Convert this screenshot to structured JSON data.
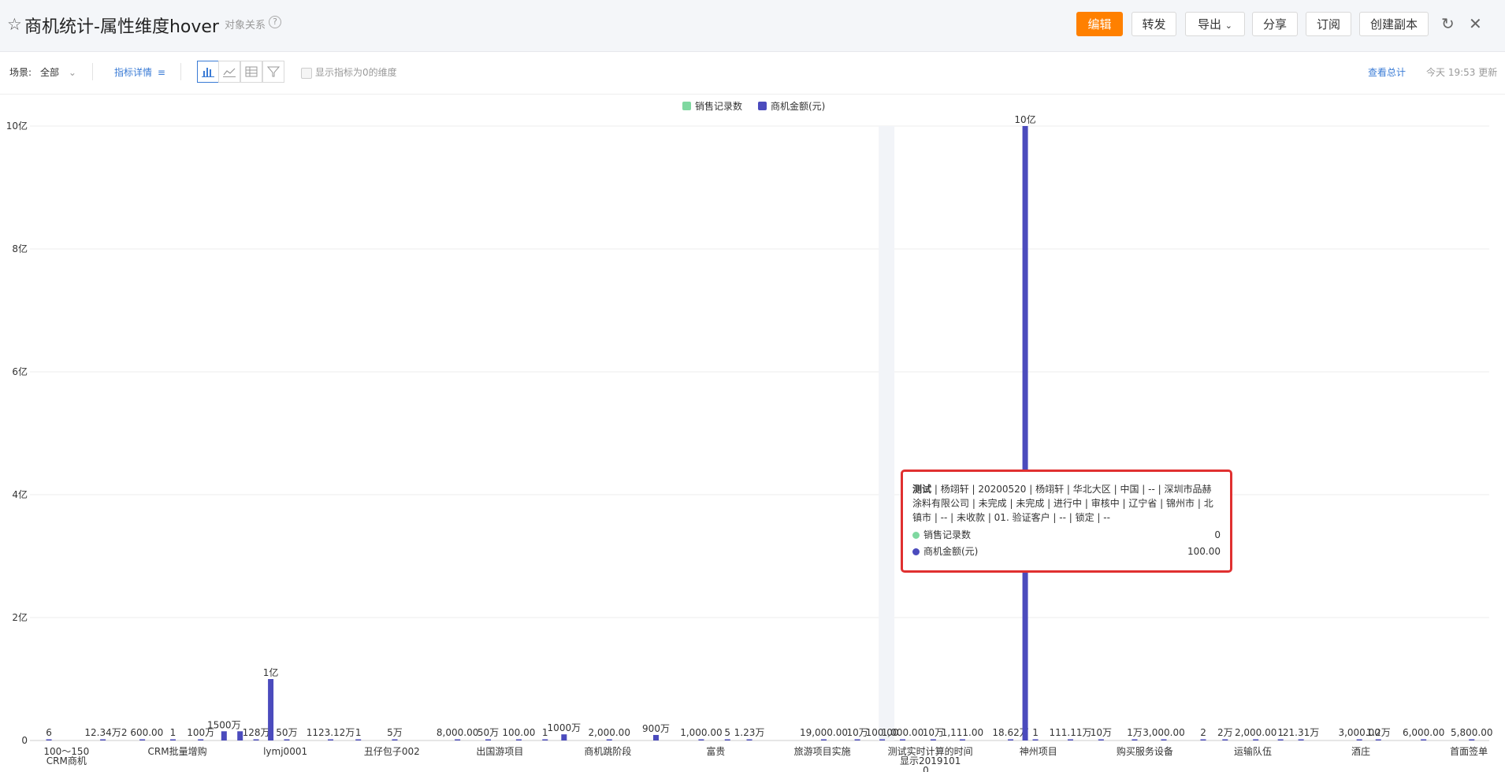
{
  "header": {
    "title": "商机统计-属性维度hover",
    "object_relation": "对象关系",
    "buttons": {
      "edit": "编辑",
      "forward": "转发",
      "export": "导出",
      "share": "分享",
      "subscribe": "订阅",
      "copy": "创建副本"
    }
  },
  "toolbar": {
    "scene_label": "场景:",
    "scene_value": "全部",
    "metric_details": "指标详情",
    "show_zero": "显示指标为0的维度",
    "view_total": "查看总计",
    "updated": "今天 19:53 更新"
  },
  "tooltip": {
    "title_bold": "测试",
    "title_rest": " | 杨翊轩 | 20200520 | 杨翊轩 | 华北大区 | 中国 | -- | 深圳市品赫涂料有限公司 | 未完成 | 未完成 | 进行中 | 审核中 | 辽宁省 | 锦州市 | 北镇市 | -- | 未收款 | 01. 验证客户 | -- | 锁定 | --",
    "rows": [
      {
        "label": "销售记录数",
        "value": "0",
        "color": "#7fd8a0"
      },
      {
        "label": "商机金额(元)",
        "value": "100.00",
        "color": "#4b4bbd"
      }
    ]
  },
  "chart_data": {
    "type": "bar",
    "legend": [
      {
        "name": "销售记录数",
        "color": "#7fd8a0"
      },
      {
        "name": "商机金额(元)",
        "color": "#4b4bbd"
      }
    ],
    "legend_position": "top-center",
    "grid": true,
    "y_ticks": [
      "0",
      "2亿",
      "4亿",
      "6亿",
      "8亿",
      "10亿"
    ],
    "ylim": [
      0,
      1000000000
    ],
    "x_tick_labels": [
      {
        "label": "100～150 CRM商机",
        "x": 0.025
      },
      {
        "label": "CRM批量增购",
        "x": 0.101
      },
      {
        "label": "lymj0001",
        "x": 0.175
      },
      {
        "label": "丑仔包子002",
        "x": 0.248
      },
      {
        "label": "出国游项目",
        "x": 0.322
      },
      {
        "label": "商机跳阶段",
        "x": 0.396
      },
      {
        "label": "富贵",
        "x": 0.47
      },
      {
        "label": "旅游项目实施",
        "x": 0.543
      },
      {
        "label": "测试实时计算的时间显示20191010...",
        "x": 0.617
      },
      {
        "label": "神州项目",
        "x": 0.691
      },
      {
        "label": "购买服务设备",
        "x": 0.764
      },
      {
        "label": "运输队伍",
        "x": 0.838
      },
      {
        "label": "酒庄",
        "x": 0.912
      },
      {
        "label": "首面签单",
        "x": 0.986
      }
    ],
    "bars": [
      {
        "x": 0.013,
        "value": 6,
        "label": "6"
      },
      {
        "x": 0.05,
        "value": 123400,
        "label": "12.34万"
      },
      {
        "x": 0.077,
        "value": 2600,
        "label": "2 600.00"
      },
      {
        "x": 0.098,
        "value": 1,
        "label": "1"
      },
      {
        "x": 0.117,
        "value": 1000000,
        "label": "100万"
      },
      {
        "x": 0.133,
        "value": 15000000,
        "label": "1500万"
      },
      {
        "x": 0.144,
        "value": 15000000,
        "label": ""
      },
      {
        "x": 0.155,
        "value": 1280000,
        "label": "128万"
      },
      {
        "x": 0.165,
        "value": 100000000,
        "label": "1亿"
      },
      {
        "x": 0.176,
        "value": 500000,
        "label": "50万"
      },
      {
        "x": 0.206,
        "value": 1231200,
        "label": "1123.12万"
      },
      {
        "x": 0.225,
        "value": 1,
        "label": "1"
      },
      {
        "x": 0.25,
        "value": 50000,
        "label": "5万"
      },
      {
        "x": 0.293,
        "value": 8000,
        "label": "8,000.00"
      },
      {
        "x": 0.314,
        "value": 500000,
        "label": "50万"
      },
      {
        "x": 0.335,
        "value": 100,
        "label": "100.00"
      },
      {
        "x": 0.353,
        "value": 1,
        "label": "1"
      },
      {
        "x": 0.366,
        "value": 10000000,
        "label": "1000万"
      },
      {
        "x": 0.397,
        "value": 2000,
        "label": "2,000.00"
      },
      {
        "x": 0.429,
        "value": 9000000,
        "label": "900万"
      },
      {
        "x": 0.46,
        "value": 1000,
        "label": "1,000.00"
      },
      {
        "x": 0.478,
        "value": 5,
        "label": "5"
      },
      {
        "x": 0.493,
        "value": 12300,
        "label": "1.23万"
      },
      {
        "x": 0.544,
        "value": 19000,
        "label": "19,000.00"
      },
      {
        "x": 0.567,
        "value": 100000,
        "label": "10万"
      },
      {
        "x": 0.584,
        "value": 100,
        "label": "100.00"
      },
      {
        "x": 0.598,
        "value": 1000,
        "label": "1,000.00"
      },
      {
        "x": 0.619,
        "value": 100000,
        "label": "10万"
      },
      {
        "x": 0.639,
        "value": 1111,
        "label": "1,111.00"
      },
      {
        "x": 0.672,
        "value": 186200,
        "label": "18.62万"
      },
      {
        "x": 0.682,
        "value": 1000000000,
        "label": "10亿"
      },
      {
        "x": 0.689,
        "value": 1,
        "label": "1"
      },
      {
        "x": 0.713,
        "value": 1111100,
        "label": "111.11万"
      },
      {
        "x": 0.734,
        "value": 100000,
        "label": "10万"
      },
      {
        "x": 0.757,
        "value": 10000,
        "label": "1万"
      },
      {
        "x": 0.777,
        "value": 3000,
        "label": "3,000.00"
      },
      {
        "x": 0.804,
        "value": 2,
        "label": "2"
      },
      {
        "x": 0.819,
        "value": 20000,
        "label": "2万"
      },
      {
        "x": 0.84,
        "value": 2000,
        "label": "2,000.00"
      },
      {
        "x": 0.857,
        "value": 1,
        "label": "1"
      },
      {
        "x": 0.871,
        "value": 213100,
        "label": "21.31万"
      },
      {
        "x": 0.911,
        "value": 3000,
        "label": "3,000.00"
      },
      {
        "x": 0.924,
        "value": 12000,
        "label": "1.2万"
      },
      {
        "x": 0.955,
        "value": 6000,
        "label": "6,000.00"
      },
      {
        "x": 0.988,
        "value": 5800,
        "label": "5,800.00"
      }
    ],
    "highlight_x": 0.587
  }
}
